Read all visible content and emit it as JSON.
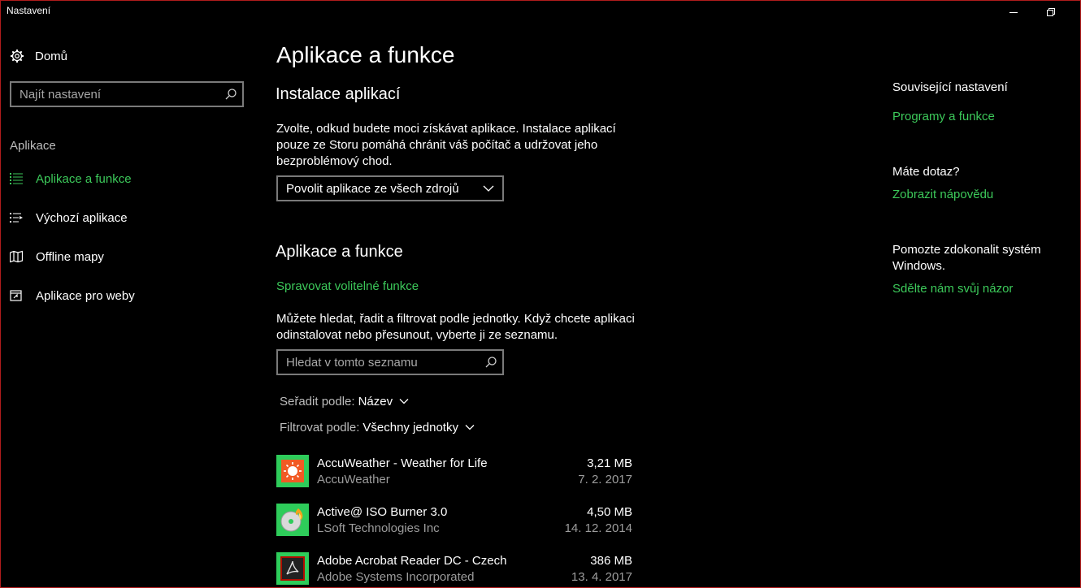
{
  "window": {
    "title": "Nastavení"
  },
  "sidebar": {
    "home_label": "Domů",
    "search_placeholder": "Najít nastavení",
    "section_heading": "Aplikace",
    "items": [
      {
        "label": "Aplikace a funkce",
        "icon": "list-icon",
        "active": true
      },
      {
        "label": "Výchozí aplikace",
        "icon": "default-apps-icon",
        "active": false
      },
      {
        "label": "Offline mapy",
        "icon": "map-icon",
        "active": false
      },
      {
        "label": "Aplikace pro weby",
        "icon": "web-app-icon",
        "active": false
      }
    ]
  },
  "main": {
    "title": "Aplikace a funkce",
    "install": {
      "heading": "Instalace aplikací",
      "description_lines": [
        "Zvolte, odkud budete moci získávat aplikace. Instalace aplikací",
        "pouze ze Storu pomáhá chránit váš počítač a udržovat jeho",
        "bezproblémový chod."
      ],
      "dropdown_value": "Povolit aplikace ze všech zdrojů"
    },
    "apps": {
      "heading": "Aplikace a funkce",
      "manage_link": "Spravovat volitelné funkce",
      "description_lines": [
        "Můžete hledat, řadit a filtrovat podle jednotky. Když chcete aplikaci",
        "odinstalovat nebo přesunout, vyberte ji ze seznamu."
      ],
      "search_placeholder": "Hledat v tomto seznamu",
      "sort_label": "Seřadit podle:",
      "sort_value": "Název",
      "filter_label": "Filtrovat podle:",
      "filter_value": "Všechny jednotky",
      "list": [
        {
          "name": "AccuWeather - Weather for Life",
          "publisher": "AccuWeather",
          "size": "3,21 MB",
          "date": "7. 2. 2017",
          "icon": "accuweather-icon"
        },
        {
          "name": "Active@ ISO Burner 3.0",
          "publisher": "LSoft Technologies Inc",
          "size": "4,50 MB",
          "date": "14. 12. 2014",
          "icon": "iso-burner-icon"
        },
        {
          "name": "Adobe Acrobat Reader DC - Czech",
          "publisher": "Adobe Systems Incorporated",
          "size": "386 MB",
          "date": "13. 4. 2017",
          "icon": "acrobat-icon"
        }
      ]
    }
  },
  "related": {
    "heading": "Související nastavení",
    "programs_link": "Programy a funkce",
    "question": "Máte dotaz?",
    "help_link": "Zobrazit nápovědu",
    "improve_lines": [
      "Pomozte zdokonalit systém",
      "Windows."
    ],
    "feedback_link": "Sdělte nám svůj názor"
  },
  "colors": {
    "accent": "#3cc95a",
    "background": "#000000",
    "app_tile": "#2ecc5a",
    "window_border": "#b01c1c"
  }
}
